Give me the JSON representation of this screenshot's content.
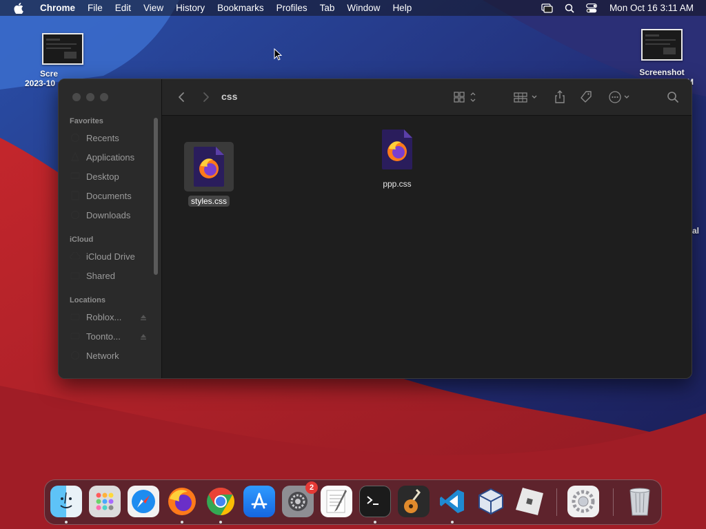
{
  "menubar": {
    "app_name": "Chrome",
    "items": [
      "File",
      "Edit",
      "View",
      "History",
      "Bookmarks",
      "Profiles",
      "Tab",
      "Window",
      "Help"
    ],
    "clock": "Mon Oct 16  3:11 AM"
  },
  "desktop": {
    "left_icon": {
      "line1": "Scre",
      "line2": "2023-10"
    },
    "right_icon": {
      "line1": "Screenshot",
      "line2": "M"
    },
    "side_fragment": "al"
  },
  "finder": {
    "current_folder": "css",
    "sidebar": {
      "favorites_title": "Favorites",
      "favorites": [
        "Recents",
        "Applications",
        "Desktop",
        "Documents",
        "Downloads"
      ],
      "icloud_title": "iCloud",
      "icloud": [
        "iCloud Drive",
        "Shared"
      ],
      "locations_title": "Locations",
      "locations": [
        "Roblox...",
        "Toonto...",
        "Network"
      ]
    },
    "files": [
      {
        "name": "styles.css",
        "selected": true
      },
      {
        "name": "ppp.css",
        "selected": false
      }
    ]
  },
  "dock": {
    "apps": [
      "Finder",
      "Launchpad",
      "Safari",
      "Firefox",
      "Chrome",
      "App Store",
      "System Settings",
      "TextEdit",
      "Terminal",
      "GarageBand",
      "Visual Studio Code",
      "VirtualBox",
      "Roblox",
      "Preferences",
      "Trash"
    ],
    "system_settings_badge": "2"
  }
}
